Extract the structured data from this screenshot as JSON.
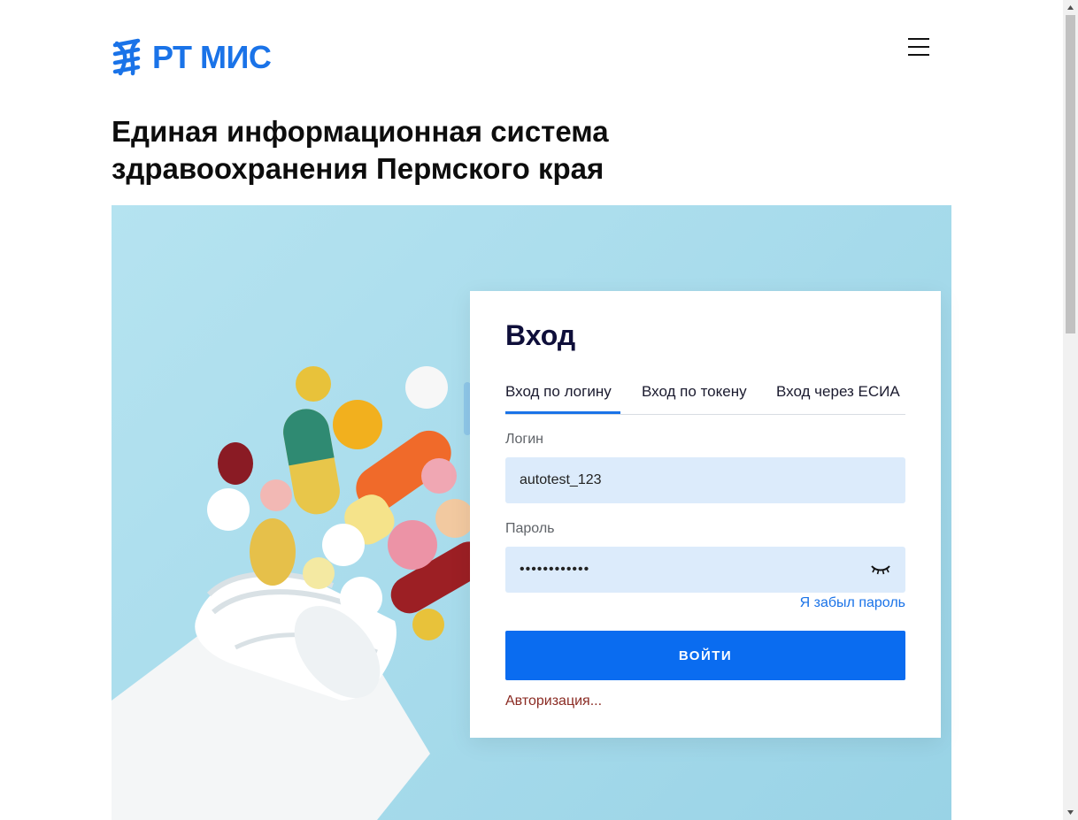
{
  "header": {
    "logo_text": "РТ МИС",
    "title": "Единая информационная система здравоохранения Пермского края"
  },
  "login": {
    "title": "Вход",
    "tabs": [
      {
        "label": "Вход по логину",
        "active": true
      },
      {
        "label": "Вход по токену",
        "active": false
      },
      {
        "label": "Вход через ЕСИА",
        "active": false
      }
    ],
    "login_label": "Логин",
    "login_value": "autotest_123",
    "password_label": "Пароль",
    "password_value": "••••••••••••",
    "forgot_link": "Я забыл пароль",
    "submit_label": "ВОЙТИ",
    "status_text": "Авторизация..."
  },
  "icons": {
    "menu": "hamburger-menu-icon",
    "password_toggle": "eye-closed-icon",
    "logo": "dna-helix-logo-icon"
  },
  "colors": {
    "accent": "#1a73e8",
    "button": "#0a6cf0",
    "input_bg": "#dcebfb",
    "status": "#8a2a22",
    "hero_bg": "#a9dcec"
  }
}
